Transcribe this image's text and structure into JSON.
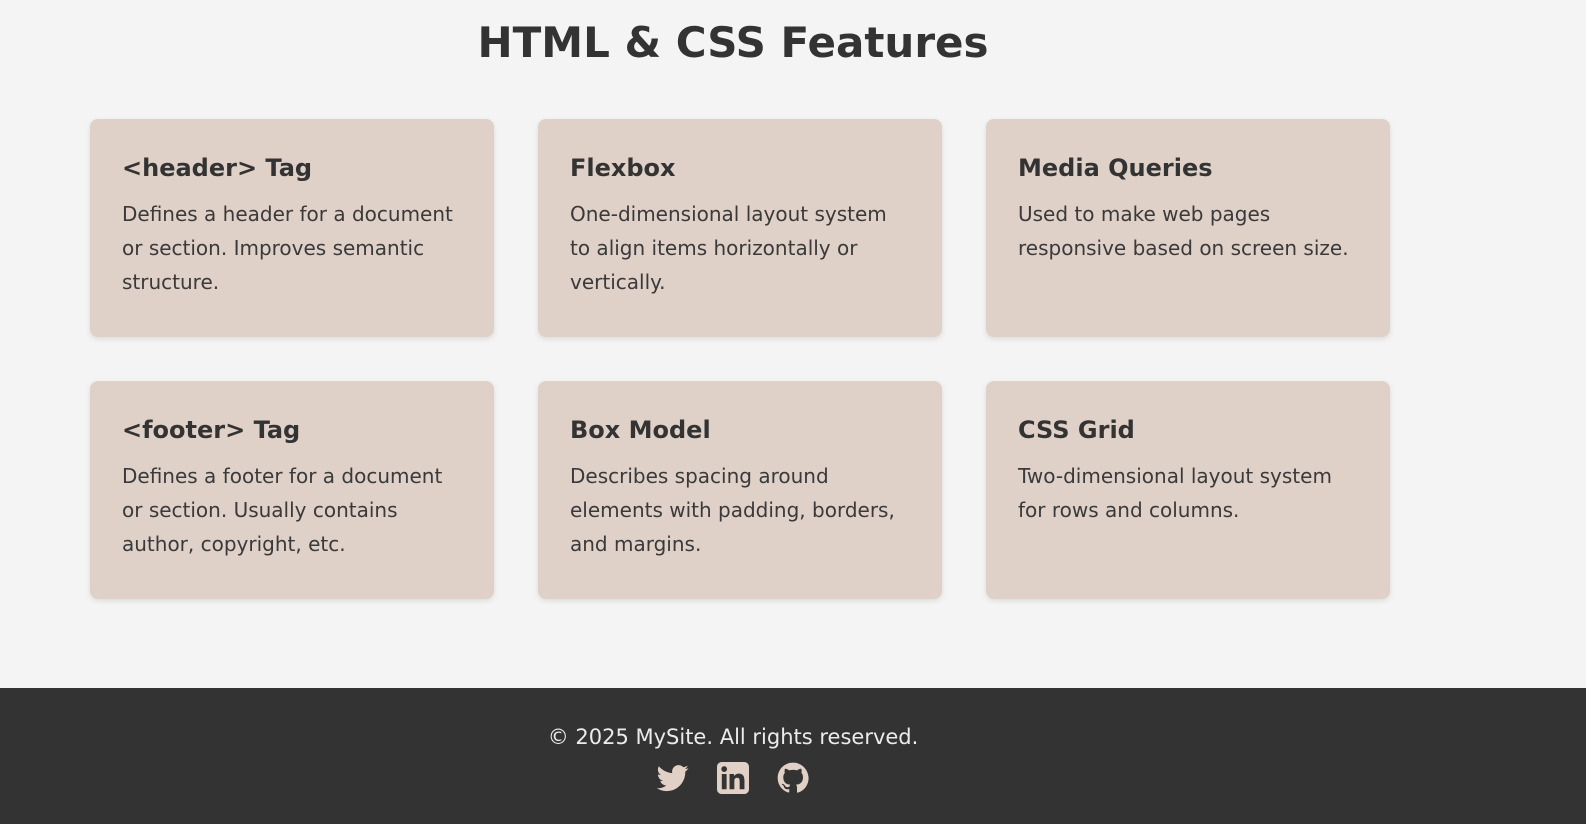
{
  "page": {
    "title": "HTML & CSS Features"
  },
  "features": [
    {
      "title": "<header> Tag",
      "description": "Defines a header for a document or section. Improves semantic structure."
    },
    {
      "title": "Flexbox",
      "description": "One-dimensional layout system to align items horizontally or vertically."
    },
    {
      "title": "Media Queries",
      "description": "Used to make web pages responsive based on screen size."
    },
    {
      "title": "<footer> Tag",
      "description": "Defines a footer for a document or section. Usually contains author, copyright, etc."
    },
    {
      "title": "Box Model",
      "description": "Describes spacing around elements with padding, borders, and margins."
    },
    {
      "title": "CSS Grid",
      "description": "Two-dimensional layout system for rows and columns."
    }
  ],
  "footer": {
    "copyright": "© 2025 MySite. All rights reserved.",
    "social": [
      {
        "icon": "twitter-icon"
      },
      {
        "icon": "linkedin-icon"
      },
      {
        "icon": "github-icon"
      }
    ]
  },
  "colors": {
    "background": "#f4f4f4",
    "card": "#dfd0c8",
    "footer": "#333333",
    "text": "#333333",
    "icon": "#e0d0c6"
  }
}
